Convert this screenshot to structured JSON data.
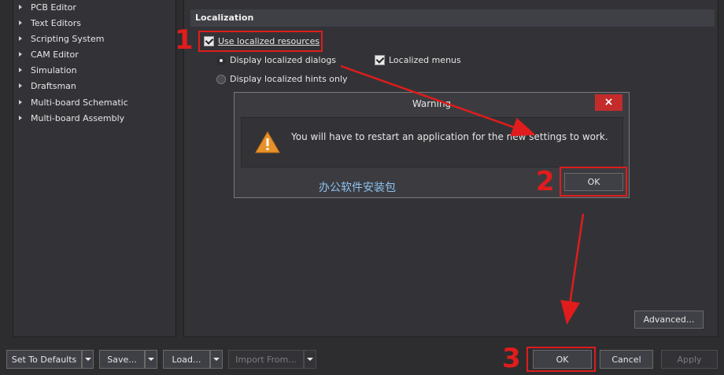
{
  "sidebar": {
    "items": [
      {
        "label": "PCB Editor"
      },
      {
        "label": "Text Editors"
      },
      {
        "label": "Scripting System"
      },
      {
        "label": "CAM Editor"
      },
      {
        "label": "Simulation"
      },
      {
        "label": "Draftsman"
      },
      {
        "label": "Multi-board Schematic"
      },
      {
        "label": "Multi-board Assembly"
      }
    ]
  },
  "section": {
    "title": "Localization",
    "use_localized": "Use localized resources",
    "display_dialogs": "Display localized dialogs",
    "display_hints": "Display localized hints only",
    "localized_menus": "Localized menus",
    "advanced_label": "Advanced..."
  },
  "dialog": {
    "title": "Warning",
    "close_label": "×",
    "message": "You will have to restart an application for the new settings to work.",
    "ok_label": "OK",
    "watermark": "办公软件安装包"
  },
  "footer": {
    "set_defaults": "Set To Defaults",
    "save": "Save...",
    "load": "Load...",
    "import_from": "Import From...",
    "ok": "OK",
    "cancel": "Cancel",
    "apply": "Apply"
  },
  "annotations": {
    "step1": "1",
    "step2": "2",
    "step3": "3",
    "color": "#e01c1c"
  }
}
